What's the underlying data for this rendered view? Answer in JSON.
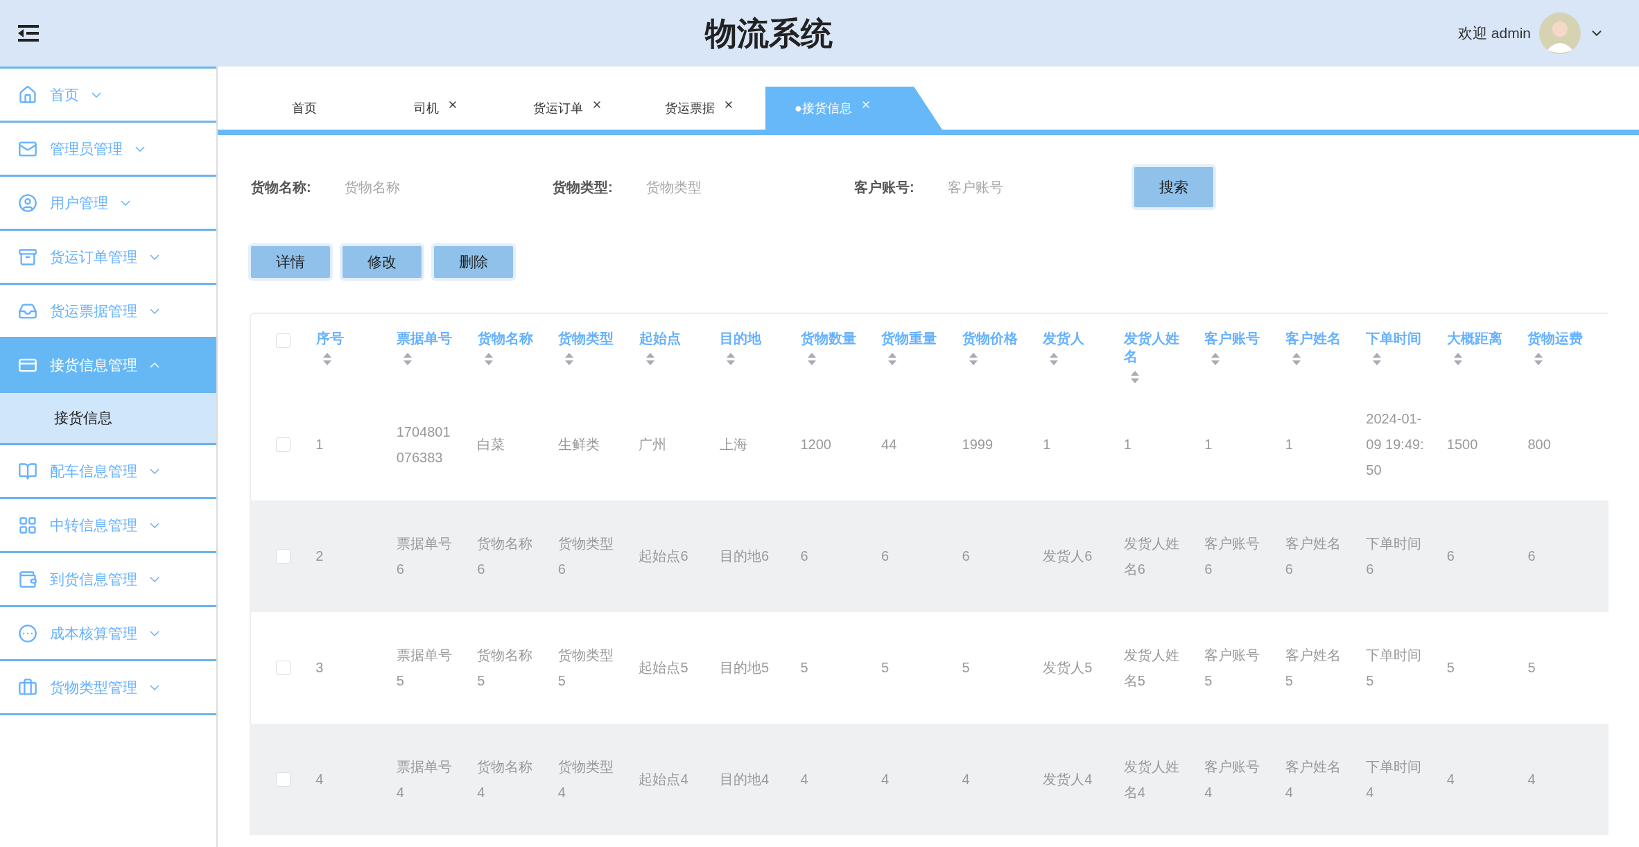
{
  "header": {
    "title": "物流系统",
    "greeting": "欢迎 admin"
  },
  "sidebar": {
    "items": [
      {
        "label": "首页",
        "expanded": false,
        "selected": false
      },
      {
        "label": "管理员管理",
        "expanded": false,
        "selected": false
      },
      {
        "label": "用户管理",
        "expanded": false,
        "selected": false
      },
      {
        "label": "货运订单管理",
        "expanded": false,
        "selected": false
      },
      {
        "label": "货运票据管理",
        "expanded": false,
        "selected": false
      },
      {
        "label": "接货信息管理",
        "expanded": true,
        "selected": true,
        "children": [
          {
            "label": "接货信息",
            "selected": true
          }
        ]
      },
      {
        "label": "配车信息管理",
        "expanded": false,
        "selected": false
      },
      {
        "label": "中转信息管理",
        "expanded": false,
        "selected": false
      },
      {
        "label": "到货信息管理",
        "expanded": false,
        "selected": false
      },
      {
        "label": "成本核算管理",
        "expanded": false,
        "selected": false
      },
      {
        "label": "货物类型管理",
        "expanded": false,
        "selected": false
      }
    ]
  },
  "tabs": [
    {
      "label": "首页",
      "closable": false,
      "selected": false
    },
    {
      "label": "司机",
      "closable": true,
      "selected": false
    },
    {
      "label": "货运订单",
      "closable": true,
      "selected": false
    },
    {
      "label": "货运票据",
      "closable": true,
      "selected": false
    },
    {
      "label": "●接货信息",
      "closable": true,
      "selected": true
    }
  ],
  "search": {
    "fields": [
      {
        "label": "货物名称:",
        "placeholder": "货物名称"
      },
      {
        "label": "货物类型:",
        "placeholder": "货物类型"
      },
      {
        "label": "客户账号:",
        "placeholder": "客户账号"
      }
    ],
    "button": "搜索"
  },
  "actions": [
    "详情",
    "修改",
    "删除"
  ],
  "table": {
    "all_checked": false,
    "columns": [
      "序号",
      "票据单号",
      "货物名称",
      "货物类型",
      "起始点",
      "目的地",
      "货物数量",
      "货物重量",
      "货物价格",
      "发货人",
      "发货人姓名",
      "客户账号",
      "客户姓名",
      "下单时间",
      "大概距离",
      "货物运费"
    ],
    "rows": [
      {
        "checked": false,
        "cells": [
          "1",
          "1704801076383",
          "白菜",
          "生鲜类",
          "广州",
          "上海",
          "1200",
          "44",
          "1999",
          "1",
          "1",
          "1",
          "1",
          "2024-01-09 19:49:50",
          "1500",
          "800"
        ]
      },
      {
        "checked": false,
        "cells": [
          "2",
          "票据单号6",
          "货物名称6",
          "货物类型6",
          "起始点6",
          "目的地6",
          "6",
          "6",
          "6",
          "发货人6",
          "发货人姓名6",
          "客户账号6",
          "客户姓名6",
          "下单时间6",
          "6",
          "6"
        ]
      },
      {
        "checked": false,
        "cells": [
          "3",
          "票据单号5",
          "货物名称5",
          "货物类型5",
          "起始点5",
          "目的地5",
          "5",
          "5",
          "5",
          "发货人5",
          "发货人姓名5",
          "客户账号5",
          "客户姓名5",
          "下单时间5",
          "5",
          "5"
        ]
      },
      {
        "checked": false,
        "cells": [
          "4",
          "票据单号4",
          "货物名称4",
          "货物类型4",
          "起始点4",
          "目的地4",
          "4",
          "4",
          "4",
          "发货人4",
          "发货人姓名4",
          "客户账号4",
          "客户姓名4",
          "下单时间4",
          "4",
          "4"
        ]
      }
    ]
  }
}
